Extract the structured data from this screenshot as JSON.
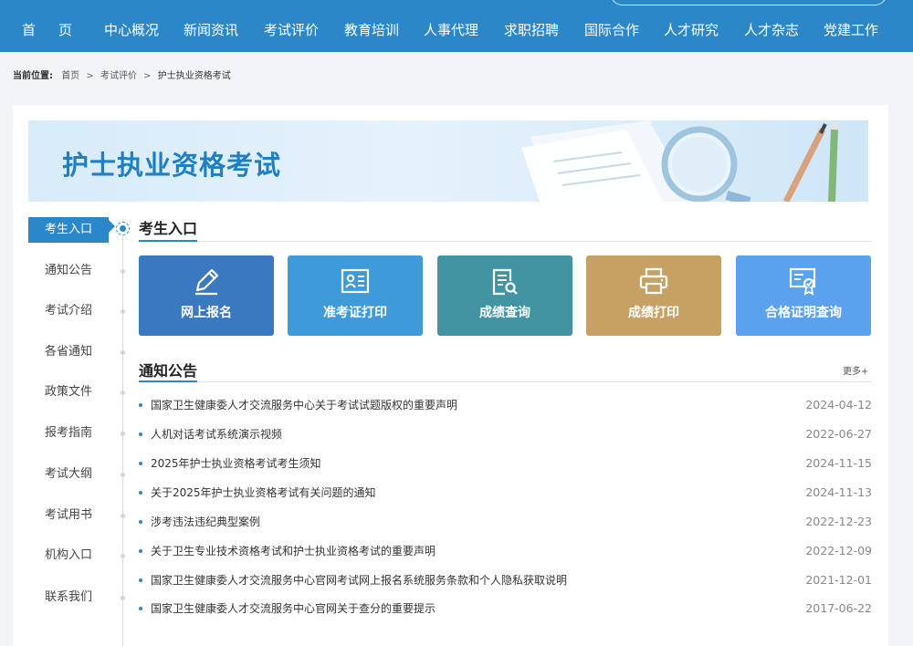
{
  "nav": {
    "items": [
      "首页",
      "中心概况",
      "新闻资讯",
      "考试评价",
      "教育培训",
      "人事代理",
      "求职招聘",
      "国际合作",
      "人才研究",
      "人才杂志",
      "党建工作"
    ]
  },
  "breadcrumb": {
    "prefix": "当前位置:",
    "items": [
      "首页",
      "考试评价",
      "护士执业资格考试"
    ],
    "separator": ">"
  },
  "banner": {
    "title": "护士执业资格考试"
  },
  "sidebar": {
    "items": [
      "考生入口",
      "通知公告",
      "考试介绍",
      "各省通知",
      "政策文件",
      "报考指南",
      "考试大纲",
      "考试用书",
      "机构入口",
      "联系我们"
    ],
    "active_index": 0
  },
  "entry_section": {
    "title": "考生入口",
    "tiles": [
      {
        "label": "网上报名",
        "icon": "pencil-icon",
        "color": "#3a78c0"
      },
      {
        "label": "准考证打印",
        "icon": "id-card-icon",
        "color": "#3f9ad9"
      },
      {
        "label": "成绩查询",
        "icon": "document-search-icon",
        "color": "#4294a3"
      },
      {
        "label": "成绩打印",
        "icon": "printer-icon",
        "color": "#c7a064"
      },
      {
        "label": "合格证明查询",
        "icon": "certificate-icon",
        "color": "#5aa1ee"
      }
    ]
  },
  "notice_section": {
    "title": "通知公告",
    "more_label": "更多+",
    "items": [
      {
        "title": "国家卫生健康委人才交流服务中心关于考试试题版权的重要声明",
        "date": "2024-04-12"
      },
      {
        "title": "人机对话考试系统演示视频",
        "date": "2022-06-27"
      },
      {
        "title": "2025年护士执业资格考试考生须知",
        "date": "2024-11-15"
      },
      {
        "title": "关于2025年护士执业资格考试有关问题的通知",
        "date": "2024-11-13"
      },
      {
        "title": "涉考违法违纪典型案例",
        "date": "2022-12-23"
      },
      {
        "title": "关于卫生专业技术资格考试和护士执业资格考试的重要声明",
        "date": "2022-12-09"
      },
      {
        "title": "国家卫生健康委人才交流服务中心官网考试网上报名系统服务条款和个人隐私获取说明",
        "date": "2021-12-01"
      },
      {
        "title": "国家卫生健康委人才交流服务中心官网关于查分的重要提示",
        "date": "2017-06-22"
      }
    ]
  },
  "colors": {
    "primary": "#2c87c8",
    "nav_bg": "#2c87c8"
  }
}
